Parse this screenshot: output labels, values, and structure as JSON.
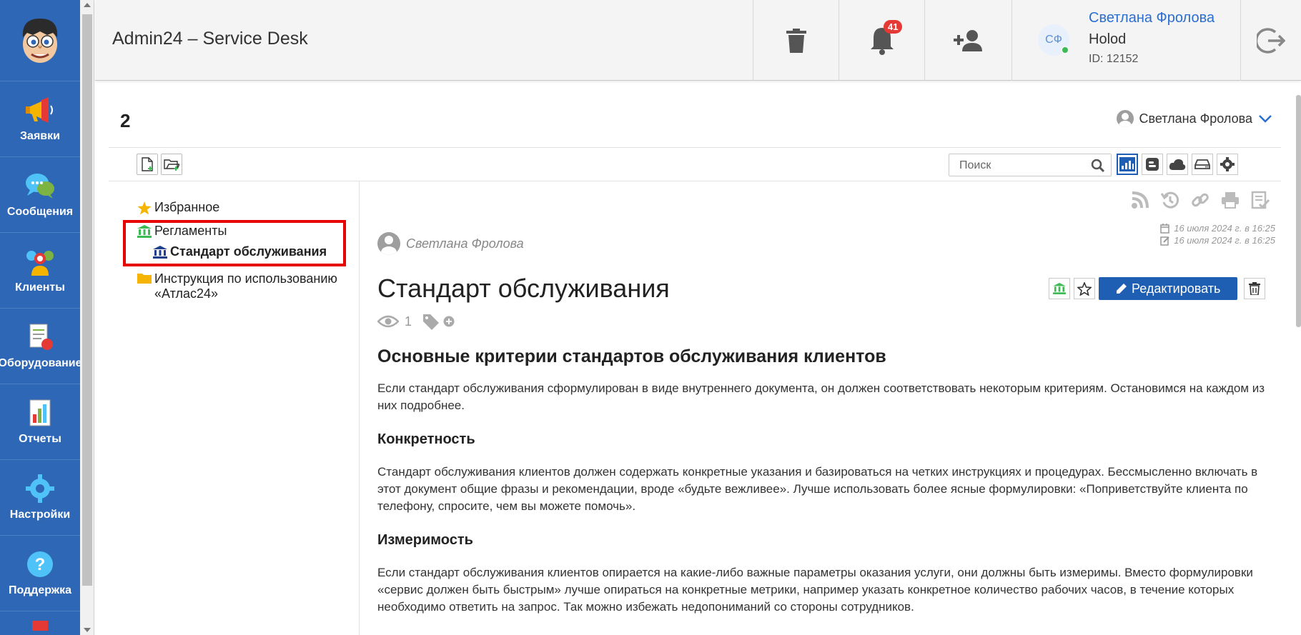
{
  "sidebar": {
    "items": [
      {
        "label": "Заявки",
        "icon": "megaphone-icon"
      },
      {
        "label": "Сообщения",
        "icon": "chat-bubbles-icon"
      },
      {
        "label": "Клиенты",
        "icon": "clients-icon"
      },
      {
        "label": "Оборудование",
        "icon": "equipment-icon"
      },
      {
        "label": "Отчеты",
        "icon": "reports-icon"
      },
      {
        "label": "Настройки",
        "icon": "gear-icon"
      },
      {
        "label": "Поддержка",
        "icon": "question-icon"
      }
    ]
  },
  "header": {
    "title": "Admin24 – Service Desk",
    "notifications_count": "41",
    "user": {
      "initials": "СФ",
      "name": "Светлана Фролова",
      "org": "Holod",
      "id_text": "ID: 12152"
    }
  },
  "kb": {
    "title": "2",
    "owner": "Светлана Фролова",
    "search_placeholder": "Поиск"
  },
  "tree": {
    "favorites": "Избранное",
    "reglaments": "Регламенты",
    "standard": "Стандарт обслуживания",
    "instruction": "Инструкция по использованию «Атлас24»"
  },
  "article": {
    "author": "Светлана Фролова",
    "created": "16 июля 2024 г. в 16:25",
    "modified": "16 июля 2024 г. в 16:25",
    "title": "Стандарт обслуживания",
    "edit_label": "Редактировать",
    "views": "1",
    "h2": "Основные критерии стандартов обслуживания клиентов",
    "p1": "Если стандарт обслуживания сформулирован в виде внутреннего документа, он должен соответствовать некоторым критериям. Остановимся на каждом из них подробнее.",
    "h3_1": "Конкретность",
    "p2": "Стандарт обслуживания клиентов должен содержать конкретные указания и базироваться на четких инструкциях и процедурах. Бессмысленно включать в этот документ общие фразы и рекомендации, вроде «будьте вежливее». Лучше использовать более ясные формулировки: «Поприветствуйте клиента по телефону, спросите, чем вы можете помочь».",
    "h3_2": "Измеримость",
    "p3": "Если стандарт обслуживания клиентов опирается на какие-либо важные параметры оказания услуги, они должны быть измеримы. Вместо формулировки «сервис должен быть быстрым» лучше опираться на конкретные метрики, например указать конкретное количество рабочих часов, в течение которых необходимо ответить на запрос. Так можно избежать недопониманий со стороны сотрудников."
  },
  "colors": {
    "sidebar": "#2e67b6",
    "primary": "#1e5fb4",
    "highlight": "#e60000",
    "badge": "#e53935",
    "link": "#2a6ed0"
  }
}
